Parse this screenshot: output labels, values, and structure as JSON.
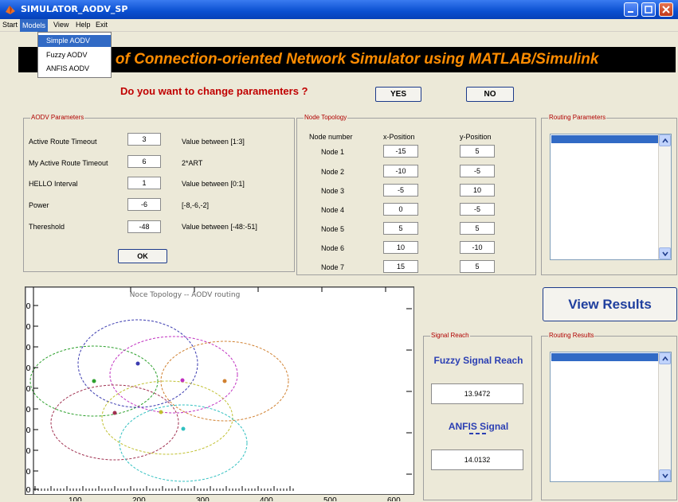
{
  "window": {
    "title": "SIMULATOR_AODV_SP"
  },
  "menu": {
    "items": [
      "Start",
      "Models",
      "View",
      "Help",
      "Exit"
    ],
    "models_dropdown": [
      "Simple AODV",
      "Fuzzy AODV",
      "ANFIS AODV"
    ]
  },
  "banner": {
    "text": "n of Connection-oriented Network Simulator using MATLAB/Simulink"
  },
  "question": {
    "text": "Do you want to change paramenters ?",
    "yes_label": "YES",
    "no_label": "NO"
  },
  "aodv_params": {
    "title": "AODV Parameters",
    "rows": [
      {
        "label": "Active Route Timeout",
        "value": "3",
        "hint": "Value between [1:3]"
      },
      {
        "label": "My Active Route Timeout",
        "value": "6",
        "hint": "2*ART"
      },
      {
        "label": "HELLO Interval",
        "value": "1",
        "hint": "Value between [0:1]"
      },
      {
        "label": "Power",
        "value": "-6",
        "hint": "[-8,-6,-2]"
      },
      {
        "label": "Thereshold",
        "value": "-48",
        "hint": "Value between [-48:-51]"
      }
    ],
    "ok_label": "OK"
  },
  "node_topology": {
    "title": "Node Topology",
    "headers": [
      "Node number",
      "x-Position",
      "y-Position"
    ],
    "rows": [
      {
        "name": "Node 1",
        "x": "-15",
        "y": "5"
      },
      {
        "name": "Node 2",
        "x": "-10",
        "y": "-5"
      },
      {
        "name": "Node 3",
        "x": "-5",
        "y": "10"
      },
      {
        "name": "Node 4",
        "x": "0",
        "y": "-5"
      },
      {
        "name": "Node 5",
        "x": "5",
        "y": "5"
      },
      {
        "name": "Node 6",
        "x": "10",
        "y": "-10"
      },
      {
        "name": "Node 7",
        "x": "15",
        "y": "5"
      }
    ]
  },
  "routing_parameters": {
    "title": "Routing Parameters"
  },
  "view_results": {
    "label": "View Results"
  },
  "signal_reach": {
    "title": "Signal Reach",
    "fuzzy_label": "Fuzzy Signal Reach",
    "fuzzy_value": "13.9472",
    "anfis_label": "ANFIS Signal",
    "anfis_value": "14.0132"
  },
  "routing_results": {
    "title": "Routing Results"
  },
  "plot": {
    "title": "Noce Topology -- AODV routing",
    "y_ticks": [
      "50",
      "00",
      "50",
      "00",
      "50",
      "00",
      "50",
      "00",
      "50",
      "00"
    ],
    "x_ticks": [
      "100",
      "200",
      "300",
      "400",
      "500",
      "600"
    ],
    "circle_colors": [
      "#2ca02c",
      "#3b3bb0",
      "#c030c0",
      "#d08030",
      "#a03050",
      "#c0c030",
      "#30c0c0"
    ]
  }
}
